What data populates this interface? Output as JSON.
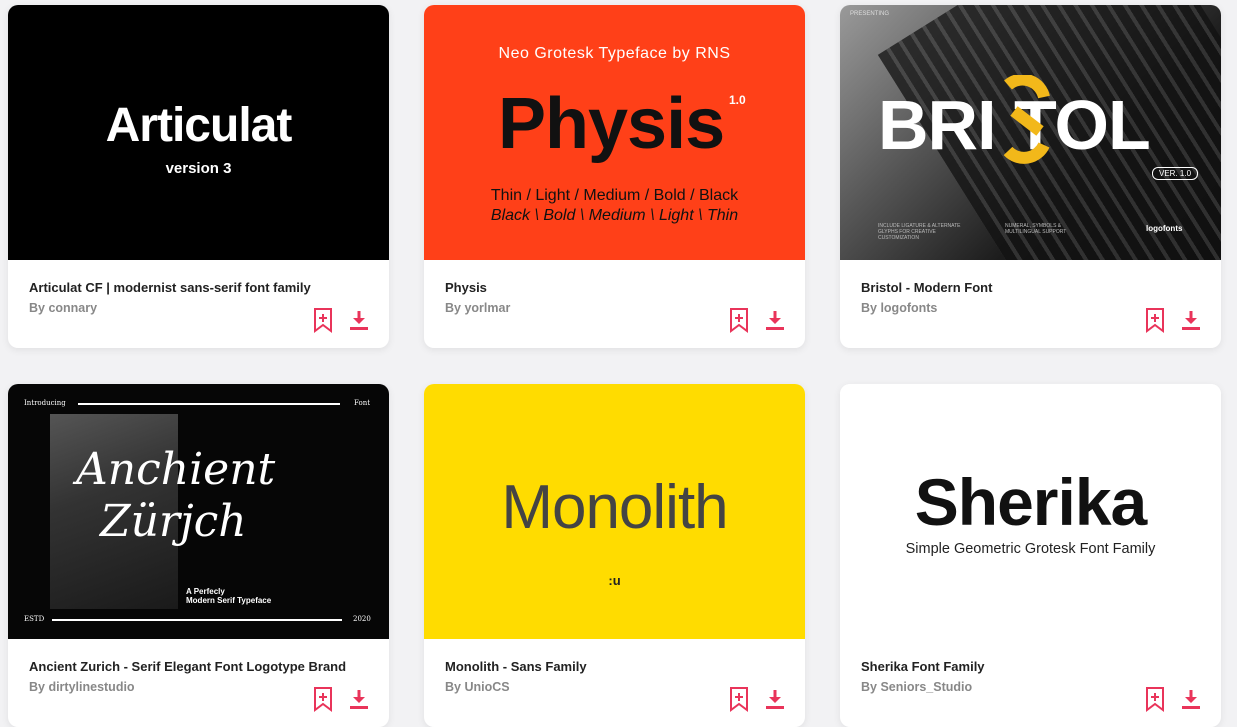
{
  "accent_color": "#e9345a",
  "cards": [
    {
      "title": "Articulat CF | modernist sans-serif font family",
      "author": "By connary",
      "preview": {
        "heading": "Articulat",
        "subheading": "version 3"
      }
    },
    {
      "title": "Physis",
      "author": "By yorlmar",
      "preview": {
        "tagline": "Neo Grotesk Typeface by RNS",
        "heading": "Physis",
        "version": "1.0",
        "weights_line1": "Thin / Light / Medium / Bold / Black",
        "weights_line2": "Black \\ Bold \\ Medium \\ Light \\ Thin"
      }
    },
    {
      "title": "Bristol - Modern Font",
      "author": "By logofonts",
      "preview": {
        "presenting": "PRESENTING",
        "heading": "BRI  TOL",
        "version": "VER. 1.0",
        "feature1": "INCLUDE LIGATURE & ALTERNATE GLYPHS FOR CREATIVE CUSTOMIZATION",
        "feature2": "NUMERAL, SYMBOLS & MULTILINGUAL SUPPORT",
        "brand": "logofonts"
      }
    },
    {
      "title": "Ancient Zurich - Serif Elegant Font Logotype Brand",
      "author": "By dirtylinestudio",
      "preview": {
        "intro": "Introducing",
        "font": "Font",
        "line1": "Anchient",
        "line2": "Zürjch",
        "sub1": "A Perfecly",
        "sub2": "Modern Serif Typeface",
        "estd": "ESTD",
        "year": "2020"
      }
    },
    {
      "title": "Monolith - Sans Family",
      "author": "By UnioCS",
      "preview": {
        "heading": "Monolith",
        "mark": ":u"
      }
    },
    {
      "title": "Sherika Font Family",
      "author": "By Seniors_Studio",
      "preview": {
        "heading": "Sherika",
        "subheading": "Simple Geometric Grotesk Font Family"
      }
    }
  ]
}
